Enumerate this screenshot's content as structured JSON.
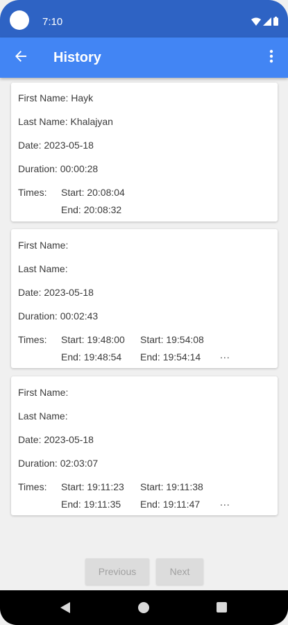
{
  "status_bar": {
    "time": "7:10"
  },
  "app_bar": {
    "title": "History"
  },
  "cards": [
    {
      "first_name": "First Name: Hayk",
      "last_name": "Last Name: Khalajyan",
      "date": "Date: 2023-05-18",
      "duration": "Duration: 00:00:28",
      "times_label": "Times:",
      "times": [
        {
          "start": "Start: 20:08:04",
          "end": "End: 20:08:32"
        }
      ],
      "more": ""
    },
    {
      "first_name": "First Name:",
      "last_name": "Last Name:",
      "date": "Date: 2023-05-18",
      "duration": "Duration: 00:02:43",
      "times_label": "Times:",
      "times": [
        {
          "start": "Start: 19:48:00",
          "end": "End: 19:48:54"
        },
        {
          "start": "Start: 19:54:08",
          "end": "End: 19:54:14"
        }
      ],
      "more": "..."
    },
    {
      "first_name": "First Name:",
      "last_name": "Last Name:",
      "date": "Date: 2023-05-18",
      "duration": "Duration: 02:03:07",
      "times_label": "Times:",
      "times": [
        {
          "start": "Start: 19:11:23",
          "end": "End: 19:11:35"
        },
        {
          "start": "Start: 19:11:38",
          "end": "End: 19:11:47"
        }
      ],
      "more": "..."
    }
  ],
  "pagination": {
    "previous_label": "Previous",
    "next_label": "Next"
  },
  "icons": {
    "back": "arrow-back-icon",
    "menu": "more-vert-icon",
    "wifi": "wifi-icon",
    "signal": "signal-icon",
    "battery": "battery-icon"
  },
  "colors": {
    "status_bar": "#2e63c4",
    "app_bar": "#4285f4",
    "background": "#f0f0f0",
    "card": "#ffffff",
    "button_disabled": "#dcdcdc"
  }
}
